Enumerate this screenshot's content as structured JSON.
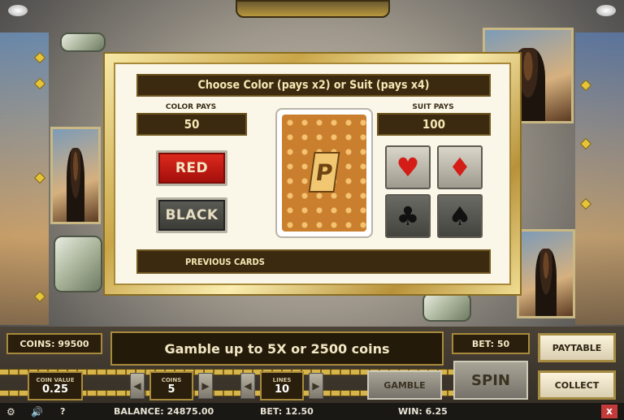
{
  "gamble_dialog": {
    "title": "Choose Color (pays x2) or Suit (pays x4)",
    "color_pays_label": "COLOR PAYS",
    "color_pays_value": "50",
    "suit_pays_label": "SUIT PAYS",
    "suit_pays_value": "100",
    "red_label": "RED",
    "black_label": "BLACK",
    "previous_cards_label": "PREVIOUS CARDS",
    "suits": [
      {
        "symbol": "♥",
        "name": "hearts",
        "color": "#d41d16"
      },
      {
        "symbol": "♦",
        "name": "diamonds",
        "color": "#d41d16"
      },
      {
        "symbol": "♣",
        "name": "clubs",
        "color": "#111111"
      },
      {
        "symbol": "♠",
        "name": "spades",
        "color": "#111111"
      }
    ],
    "card_logo": "P"
  },
  "hud": {
    "coins_label": "COINS: 99500",
    "message": "Gamble up to 5X or 2500 coins",
    "bet_label": "BET: 50",
    "paytable_label": "PAYTABLE",
    "coin_value_label": "COIN VALUE",
    "coin_value": "0.25",
    "coins_stepper_label": "COINS",
    "coins_stepper_value": "5",
    "lines_label": "LINES",
    "lines_value": "10",
    "gamble_label": "GAMBLE",
    "spin_label": "SPIN",
    "collect_label": "COLLECT"
  },
  "status": {
    "balance": "BALANCE: 24875.00",
    "bet": "BET: 12.50",
    "win": "WIN: 6.25",
    "help": "?",
    "close": "x"
  }
}
